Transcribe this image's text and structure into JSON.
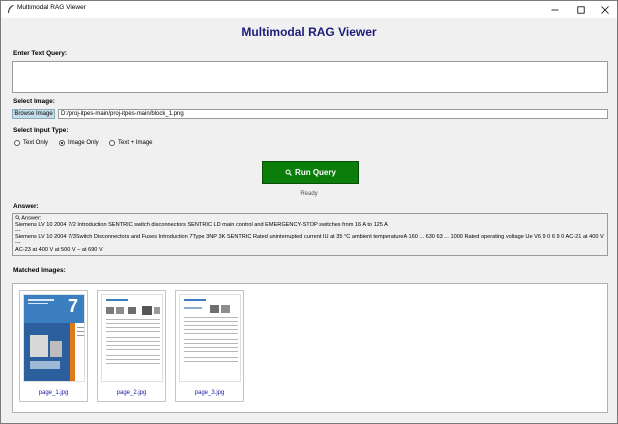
{
  "window": {
    "title": "Multimodal RAG Viewer",
    "minimize_icon": "minimize-icon",
    "maximize_icon": "maximize-icon",
    "close_icon": "close-icon"
  },
  "header": {
    "title": "Multimodal RAG Viewer"
  },
  "query": {
    "label": "Enter Text Query:",
    "value": ""
  },
  "image_select": {
    "label": "Select Image:",
    "browse_label": "Browse Image",
    "path": "D:/proj-itpes-main/proj-itpes-main/block_1.png"
  },
  "input_type": {
    "label": "Select Input Type:",
    "options": [
      "Text Only",
      "Image Only",
      "Text + Image"
    ],
    "selected": "Image Only"
  },
  "run": {
    "label": "Run Query",
    "icon": "search-icon",
    "color": "#0a7d0a"
  },
  "status": {
    "text": "Ready"
  },
  "answer": {
    "label": "Answer:",
    "lines": [
      "Answer:",
      "Siemens LV 10 2004 7/2 Introduction SENTRIC switch disconnectors SENTRIC LD main control and EMERGENCY-STOP switches from 16 A to 125 A",
      "---",
      "Siemens LV 10 2004 7/3Switch Disconnectors and Fuses Introduction 7Type 3NP 3K SENTRIC Rated uninterrupted current IU at 35 °C ambient temperatureA 160 ... 630 63 ... 1000 Rated operating voltage Ue V6 9 0 6 9 0 AC-21 at 400 V",
      "---",
      "AC-23 at 400 V at 500 V – at 690 V"
    ]
  },
  "matched": {
    "label": "Matched Images:",
    "images": [
      {
        "caption": "page_1.jpg",
        "number": "7"
      },
      {
        "caption": "page_2.jpg"
      },
      {
        "caption": "page_3.jpg"
      }
    ]
  }
}
